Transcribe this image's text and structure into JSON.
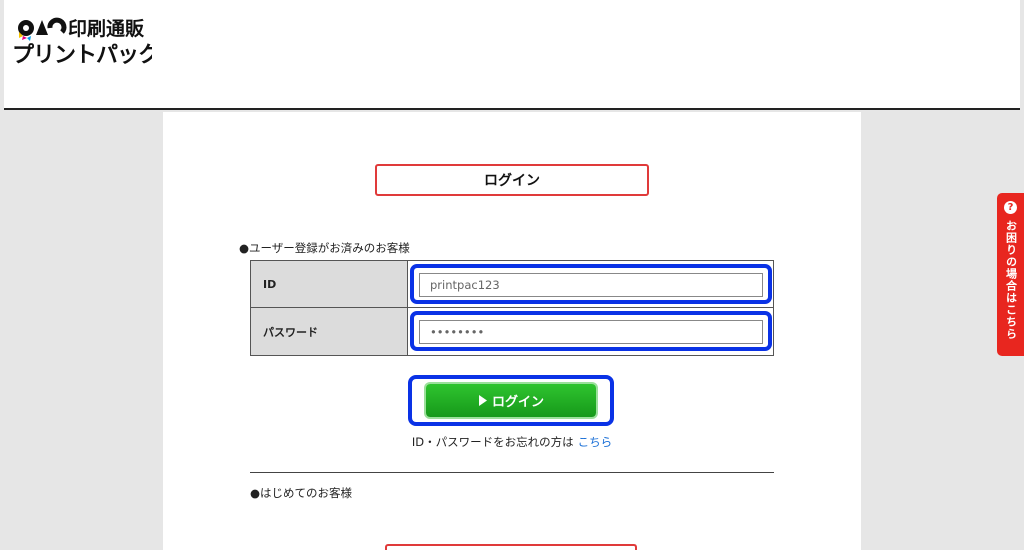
{
  "logo": {
    "top_text": "印刷通販",
    "brand_mark": "PAC",
    "bottom_text": "プリントパック"
  },
  "page_title": "ログイン",
  "existing_customer_label": "●ユーザー登録がお済みのお客様",
  "form": {
    "id_label": "ID",
    "id_value": "printpac123",
    "password_label": "パスワード",
    "password_value": "••••••••"
  },
  "login_button": {
    "icon": "play-triangle-icon",
    "label": "ログイン"
  },
  "forgot": {
    "text": "ID・パスワードをお忘れの方は",
    "link": "こちら"
  },
  "new_customer_label": "●はじめてのお客様",
  "help_tab": {
    "icon": "question-icon",
    "label": "お困りの場合はこちら"
  },
  "colors": {
    "accent_red": "#e03a3a",
    "highlight_blue": "#0a32e6",
    "button_green": "#16991a",
    "link_blue": "#1a6fd6"
  }
}
